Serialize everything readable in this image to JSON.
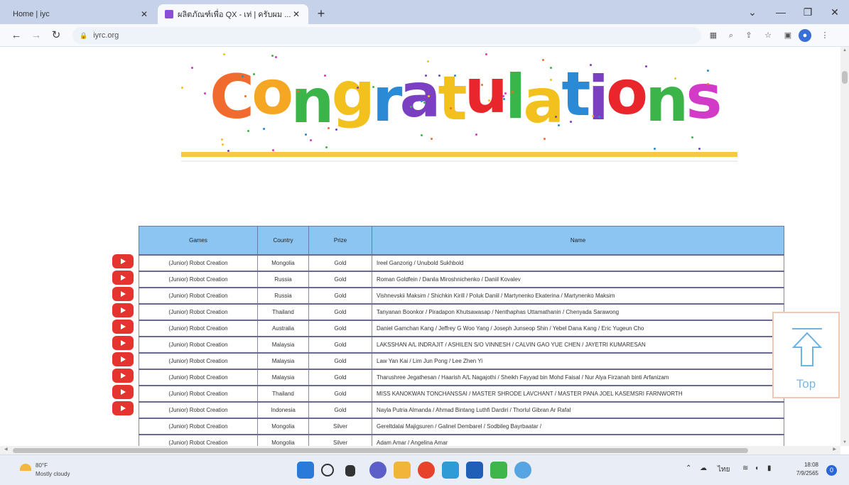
{
  "browser": {
    "tabs": [
      {
        "title": "Home | iyc",
        "active": false
      },
      {
        "title": "ผลิตภัณฑ์เพื่อ QX - เท่ | ครับผม ...",
        "active": true
      }
    ],
    "address": "iyrc.org",
    "new_tab_icon": "+",
    "window_controls": {
      "tab_search": "⌄",
      "minimize": "—",
      "restore": "❐",
      "close": "✕"
    }
  },
  "banner": {
    "word": "Congratulations",
    "letter_colors": [
      "#f26b2e",
      "#f5a623",
      "#3bb54a",
      "#f2c11d",
      "#2b8ad6",
      "#7b3fc2",
      "#f2c11d",
      "#e8262b",
      "#3bb54a",
      "#f2c11d",
      "#2b8ad6",
      "#7b3fc2",
      "#e8262b",
      "#3bb54a",
      "#d23ac8"
    ],
    "rule_color": "#f7c844"
  },
  "results": {
    "headers": [
      "Games",
      "Country",
      "Prize",
      "Name"
    ],
    "rows": [
      {
        "game": "(Junior) Robot Creation",
        "country": "Mongolia",
        "prize": "Gold",
        "name": "Ireel Ganzorig / Unubold Sukhbold"
      },
      {
        "game": "(Junior) Robot Creation",
        "country": "Russia",
        "prize": "Gold",
        "name": "Roman Goldfein / Danila Miroshnichenko / Daniil Kovalev"
      },
      {
        "game": "(Junior) Robot Creation",
        "country": "Russia",
        "prize": "Gold",
        "name": "Vishnevskii Maksim / Shichkin Kirill / Poluk Daniil / Martynenko Ekaterina / Martynenko Maksim"
      },
      {
        "game": "(Junior) Robot Creation",
        "country": "Thailand",
        "prize": "Gold",
        "name": "Tanyanan Boonkor / Piradapon Khutsawasap / Nenthaphas Uttamathanin / Chenyada Sarawong"
      },
      {
        "game": "(Junior) Robot Creation",
        "country": "Australia",
        "prize": "Gold",
        "name": "Daniel Gamchan Kang / Jeffrey G Woo Yang / Joseph Junseop Shin / Yebel Dana Kang / Eric Yugeun Cho"
      },
      {
        "game": "(Junior) Robot Creation",
        "country": "Malaysia",
        "prize": "Gold",
        "name": "LAKSSHAN A/L INDRAJIT / ASHILEN S/O VINNESH / CALVIN GAO YUE CHEN / JAYETRI KUMARESAN"
      },
      {
        "game": "(Junior) Robot Creation",
        "country": "Malaysia",
        "prize": "Gold",
        "name": "Law Yan Kai / Lim Jun Pong / Lee Zhen Yi"
      },
      {
        "game": "(Junior) Robot Creation",
        "country": "Malaysia",
        "prize": "Gold",
        "name": "Tharushree Jegathesan / Haarish A/L Nagajothi / Sheikh Fayyad bin Mohd Faisal / Nur Alya Firzanah binti Arfanizam"
      },
      {
        "game": "(Junior) Robot Creation",
        "country": "Thailand",
        "prize": "Gold",
        "name": "MISS KANOKWAN TONCHANSSAI / MASTER SHRODE LAVCHANT / MASTER PANA JOEL KASEMSRI FARNWORTH"
      },
      {
        "game": "(Junior) Robot Creation",
        "country": "Indonesia",
        "prize": "Gold",
        "name": "Nayla Putria Almanda / Ahmad Bintang Luthfi Dardiri / Thorlul Gibran Ar Rafal"
      },
      {
        "game": "(Junior) Robot Creation",
        "country": "Mongolia",
        "prize": "Silver",
        "name": "Gereltdalai Majigsuren / Galinel Dembarel / Sodbileg Bayrbaatar /"
      },
      {
        "game": "(Junior) Robot Creation",
        "country": "Mongolia",
        "prize": "Silver",
        "name": "Adam Amar / Angelina Amar"
      }
    ],
    "video_icon_count": 10
  },
  "top_button": {
    "label": "Top",
    "icon": "arrow-up-outline-icon"
  },
  "taskbar": {
    "weather": {
      "temp": "80°F",
      "condition": "Mostly cloudy"
    },
    "clock": {
      "time": "18:08",
      "date": "7/9/2565"
    },
    "tray_lang": "ไทย",
    "notifications": "0"
  }
}
